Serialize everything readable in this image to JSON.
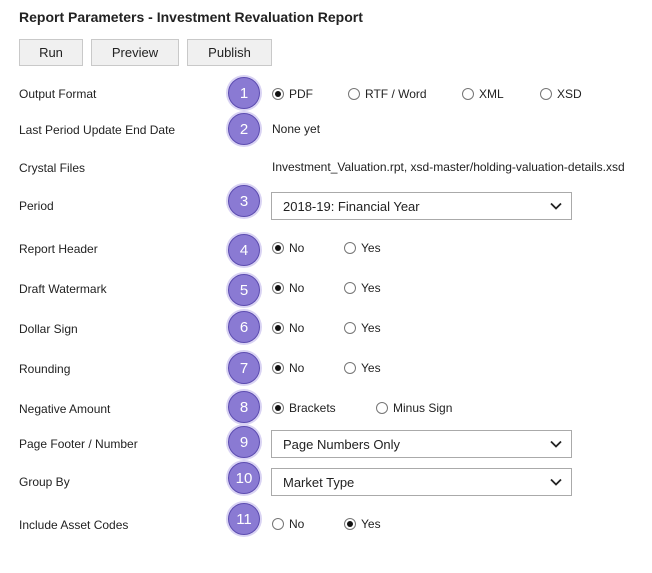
{
  "title": "Report Parameters - Investment Revaluation Report",
  "toolbar": {
    "run": "Run",
    "preview": "Preview",
    "publish": "Publish"
  },
  "fields": {
    "output_format": {
      "label": "Output Format",
      "badge": "1",
      "options": [
        "PDF",
        "RTF / Word",
        "XML",
        "XSD"
      ],
      "selected": "PDF"
    },
    "last_period": {
      "label": "Last Period Update End Date",
      "badge": "2",
      "value": "None yet"
    },
    "crystal_files": {
      "label": "Crystal Files",
      "value": "Investment_Valuation.rpt, xsd-master/holding-valuation-details.xsd"
    },
    "period": {
      "label": "Period",
      "badge": "3",
      "value": "2018-19: Financial Year"
    },
    "report_header": {
      "label": "Report Header",
      "badge": "4",
      "options": [
        "No",
        "Yes"
      ],
      "selected": "No"
    },
    "draft_watermark": {
      "label": "Draft Watermark",
      "badge": "5",
      "options": [
        "No",
        "Yes"
      ],
      "selected": "No"
    },
    "dollar_sign": {
      "label": "Dollar Sign",
      "badge": "6",
      "options": [
        "No",
        "Yes"
      ],
      "selected": "No"
    },
    "rounding": {
      "label": "Rounding",
      "badge": "7",
      "options": [
        "No",
        "Yes"
      ],
      "selected": "No"
    },
    "negative_amount": {
      "label": "Negative Amount",
      "badge": "8",
      "options": [
        "Brackets",
        "Minus Sign"
      ],
      "selected": "Brackets"
    },
    "page_footer": {
      "label": "Page Footer / Number",
      "badge": "9",
      "value": "Page Numbers Only"
    },
    "group_by": {
      "label": "Group By",
      "badge": "10",
      "value": "Market Type"
    },
    "include_asset_codes": {
      "label": "Include Asset Codes",
      "badge": "11",
      "options": [
        "No",
        "Yes"
      ],
      "selected": "Yes"
    }
  },
  "icons": {
    "chevron": "chevron-down-icon",
    "badge_color": "#8a7ad3"
  }
}
